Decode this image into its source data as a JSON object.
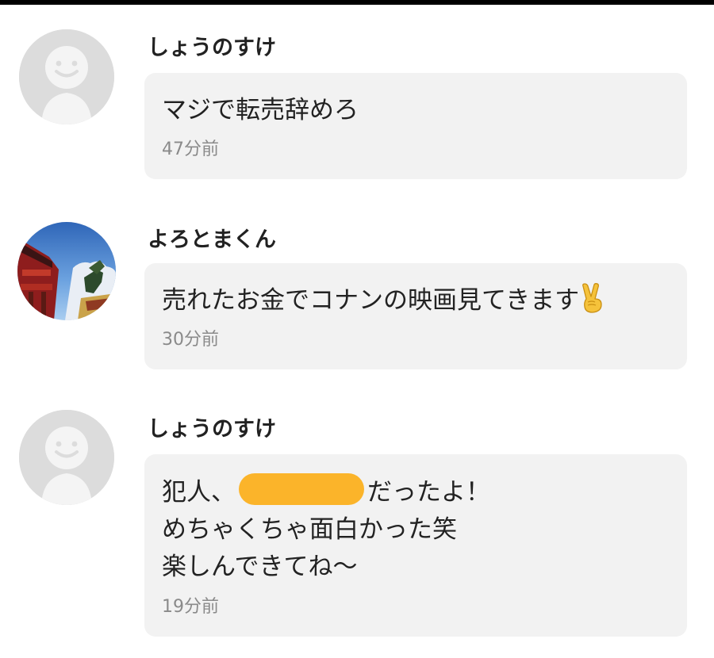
{
  "comments": [
    {
      "username": "しょうのすけ",
      "avatar_icon": "default-user-icon",
      "message": "マジで転売辞めろ",
      "time": "47分前"
    },
    {
      "username": "よろとまくん",
      "avatar_icon": "user-photo-avatar",
      "message": "売れたお金でコナンの映画見てきます",
      "emoji": "victory-hand-emoji",
      "time": "30分前"
    },
    {
      "username": "しょうのすけ",
      "avatar_icon": "default-user-icon",
      "lines": {
        "line1_prefix": "犯人、",
        "line1_suffix": "だったよ！",
        "line2": "めちゃくちゃ面白かった笑",
        "line3": "楽しんできてね〜"
      },
      "redaction_color": "#fbb42a",
      "time": "19分前"
    }
  ],
  "colors": {
    "bubble_bg": "#f2f2f2",
    "avatar_default_bg": "#dcdcdc",
    "time_text": "#8a8a8a"
  }
}
